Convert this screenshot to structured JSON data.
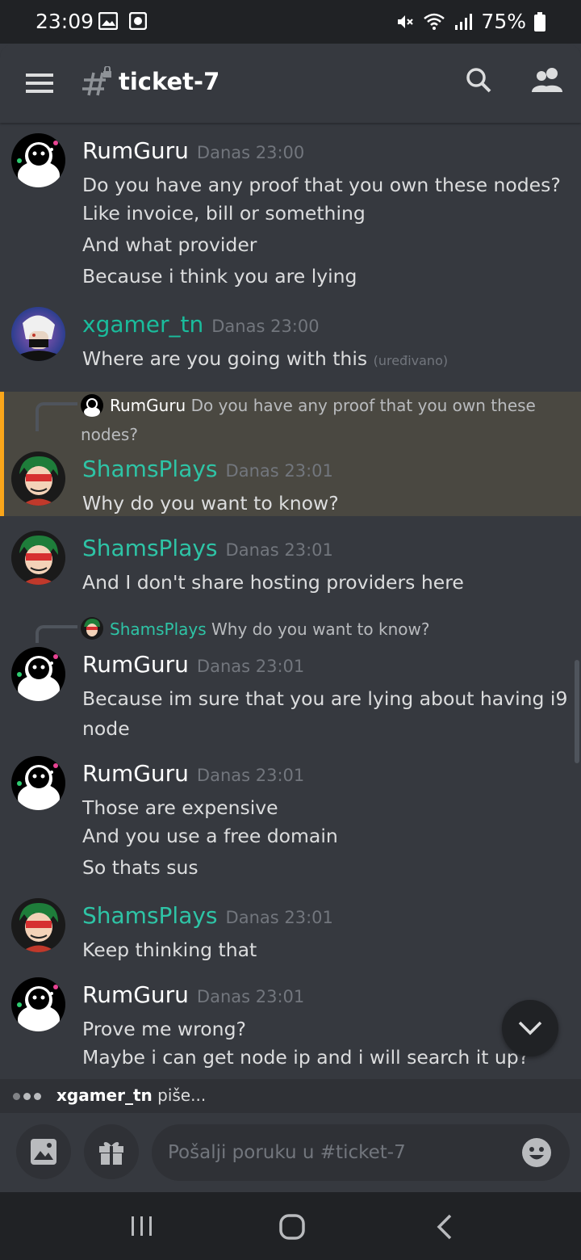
{
  "status_bar": {
    "time": "23:09",
    "battery": "75%"
  },
  "header": {
    "channel": "ticket-7"
  },
  "messages": [
    {
      "author": "RumGuru",
      "timestamp": "Danas 23:00",
      "lines": [
        "Do you have any proof that you own these nodes?",
        "Like invoice, bill or something",
        "And what provider",
        "Because i think you are lying"
      ]
    },
    {
      "author": "xgamer_tn",
      "timestamp": "Danas 23:00",
      "lines": [
        "Where are you going with this"
      ],
      "edited": "(uređivano)"
    },
    {
      "reply_to": {
        "author": "RumGuru",
        "text_1": "Do you have any proof that you own these",
        "text_2": "nodes?"
      },
      "author": "ShamsPlays",
      "timestamp": "Danas 23:01",
      "lines": [
        "Why do you want to know?"
      ],
      "highlighted": true
    },
    {
      "author": "ShamsPlays",
      "timestamp": "Danas 23:01",
      "lines": [
        "And I don't share hosting providers here"
      ]
    },
    {
      "reply_to": {
        "author": "ShamsPlays",
        "text_1": "Why do you want to know?"
      },
      "author": "RumGuru",
      "timestamp": "Danas 23:01",
      "lines": [
        "Because im sure that you are lying about having i9",
        "node"
      ]
    },
    {
      "author": "RumGuru",
      "timestamp": "Danas 23:01",
      "lines": [
        "Those are expensive",
        "And you use a free domain",
        "So thats sus"
      ]
    },
    {
      "author": "ShamsPlays",
      "timestamp": "Danas 23:01",
      "lines": [
        "Keep thinking that"
      ]
    },
    {
      "author": "RumGuru",
      "timestamp": "Danas 23:01",
      "lines": [
        "Prove me wrong?",
        "Maybe i can get node ip and i will search it up?"
      ]
    }
  ],
  "typing": {
    "user": "xgamer_tn",
    "suffix": " piše..."
  },
  "composer": {
    "placeholder": "Pošalji poruku u #ticket-7"
  },
  "colors": {
    "background": "#36393f",
    "header_bg": "#202225",
    "teal_name": "#1abc9c",
    "highlight_bar": "#faa61a",
    "highlight_bg": "#4a4841"
  },
  "icons": [
    "menu-icon",
    "channel-hash-lock-icon",
    "search-icon",
    "members-icon",
    "image-icon",
    "gift-icon",
    "emoji-icon",
    "chevron-down-icon",
    "nav-recents-icon",
    "nav-home-icon",
    "nav-back-icon"
  ]
}
